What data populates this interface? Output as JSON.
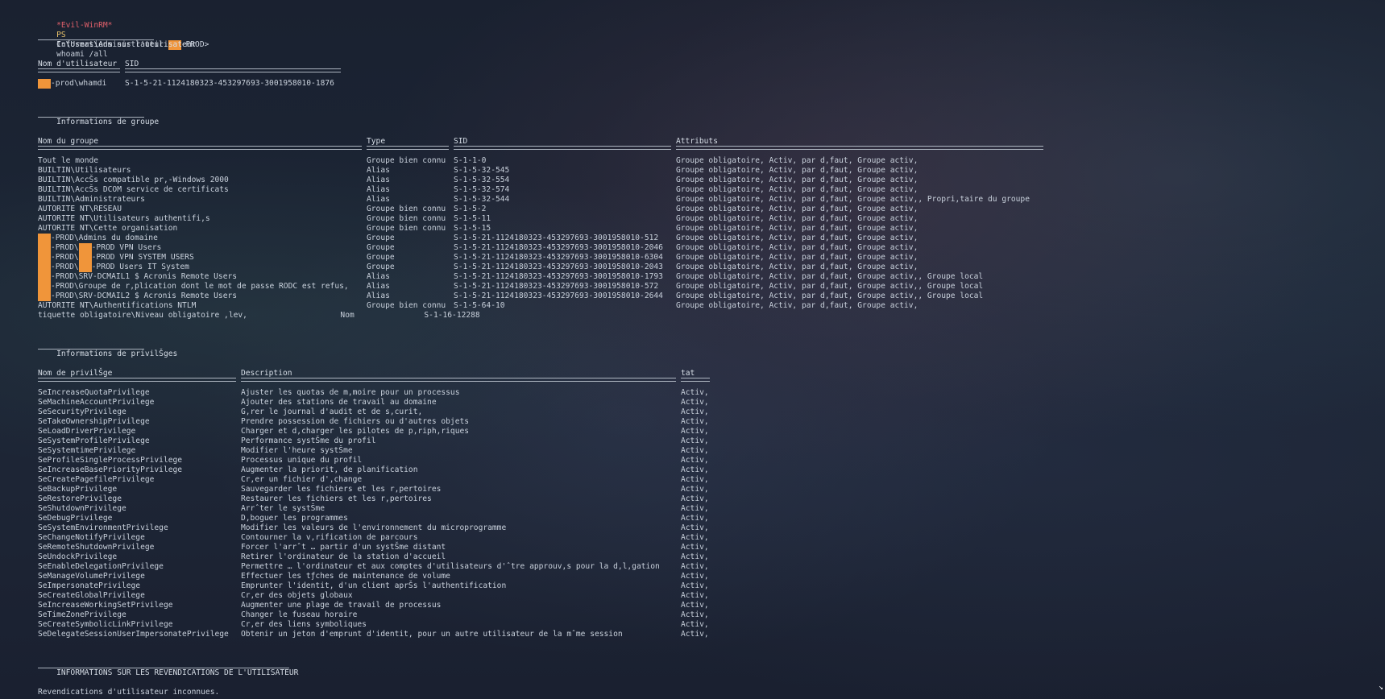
{
  "prompt": {
    "evil": "*Evil-WinRM*",
    "ps": "PS",
    "path_prefix": "C:\\Users\\Administrateur.",
    "path_suffix": "-PROD>",
    "command": "whoami /all"
  },
  "user_section": {
    "title": "Informations sur l'utilisateur",
    "col_user": "Nom d'utilisateur",
    "col_sid": "SID",
    "user_suffix": "-prod\\whamdi",
    "user_sid": "S-1-5-21-1124180323-453297693-3001958010-1876"
  },
  "group_section": {
    "title": "Informations de groupe",
    "headers": [
      "Nom du groupe",
      "Type",
      "SID",
      "Attributs"
    ],
    "rows": [
      {
        "name": "Tout le monde",
        "type": "Groupe bien connu",
        "sid": "S-1-1-0",
        "attr": "Groupe obligatoire, Activ, par d,faut, Groupe activ,"
      },
      {
        "name": "BUILTIN\\Utilisateurs",
        "type": "Alias",
        "sid": "S-1-5-32-545",
        "attr": "Groupe obligatoire, Activ, par d,faut, Groupe activ,"
      },
      {
        "name": "BUILTIN\\AccŠs compatible pr,-Windows 2000",
        "type": "Alias",
        "sid": "S-1-5-32-554",
        "attr": "Groupe obligatoire, Activ, par d,faut, Groupe activ,"
      },
      {
        "name": "BUILTIN\\AccŠs DCOM service de certificats",
        "type": "Alias",
        "sid": "S-1-5-32-574",
        "attr": "Groupe obligatoire, Activ, par d,faut, Groupe activ,"
      },
      {
        "name": "BUILTIN\\Administrateurs",
        "type": "Alias",
        "sid": "S-1-5-32-544",
        "attr": "Groupe obligatoire, Activ, par d,faut, Groupe activ,, Propri,taire du groupe"
      },
      {
        "name": "AUTORITE NT\\RESEAU",
        "type": "Groupe bien connu",
        "sid": "S-1-5-2",
        "attr": "Groupe obligatoire, Activ, par d,faut, Groupe activ,"
      },
      {
        "name": "AUTORITE NT\\Utilisateurs authentifi,s",
        "type": "Groupe bien connu",
        "sid": "S-1-5-11",
        "attr": "Groupe obligatoire, Activ, par d,faut, Groupe activ,"
      },
      {
        "name": "AUTORITE NT\\Cette organisation",
        "type": "Groupe bien connu",
        "sid": "S-1-5-15",
        "attr": "Groupe obligatoire, Activ, par d,faut, Groupe activ,"
      },
      {
        "name": "-PROD\\Admins du domaine",
        "type": "Groupe",
        "sid": "S-1-5-21-1124180323-453297693-3001958010-512",
        "attr": "Groupe obligatoire, Activ, par d,faut, Groupe activ,",
        "redacted": 1
      },
      {
        "name": "-PROD\\   -PROD VPN Users",
        "type": "Groupe",
        "sid": "S-1-5-21-1124180323-453297693-3001958010-2046",
        "attr": "Groupe obligatoire, Activ, par d,faut, Groupe activ,",
        "redacted": 2
      },
      {
        "name": "-PROD\\   -PROD VPN SYSTEM USERS",
        "type": "Groupe",
        "sid": "S-1-5-21-1124180323-453297693-3001958010-6304",
        "attr": "Groupe obligatoire, Activ, par d,faut, Groupe activ,",
        "redacted": 2
      },
      {
        "name": "-PROD\\   -PROD Users IT System",
        "type": "Groupe",
        "sid": "S-1-5-21-1124180323-453297693-3001958010-2043",
        "attr": "Groupe obligatoire, Activ, par d,faut, Groupe activ,",
        "redacted": 2
      },
      {
        "name": "-PROD\\SRV-DCMAIL1 $ Acronis Remote Users",
        "type": "Alias",
        "sid": "S-1-5-21-1124180323-453297693-3001958010-1793",
        "attr": "Groupe obligatoire, Activ, par d,faut, Groupe activ,, Groupe local",
        "redacted": 1
      },
      {
        "name": "-PROD\\Groupe de r,plication dont le mot de passe RODC est refus,",
        "type": "Alias",
        "sid": "S-1-5-21-1124180323-453297693-3001958010-572",
        "attr": "Groupe obligatoire, Activ, par d,faut, Groupe activ,, Groupe local",
        "redacted": 1
      },
      {
        "name": "-PROD\\SRV-DCMAIL2 $ Acronis Remote Users",
        "type": "Alias",
        "sid": "S-1-5-21-1124180323-453297693-3001958010-2644",
        "attr": "Groupe obligatoire, Activ, par d,faut, Groupe activ,, Groupe local",
        "redacted": 1
      },
      {
        "name": "AUTORITE NT\\Authentifications NTLM",
        "type": "Groupe bien connu",
        "sid": "S-1-5-64-10",
        "attr": "Groupe obligatoire, Activ, par d,faut, Groupe activ,"
      }
    ],
    "last_line": "tiquette obligatoire\\Niveau obligatoire ,lev,                    Nom               S-1-16-12288"
  },
  "priv_section": {
    "title": "Informations de privilŠges",
    "headers": [
      "Nom de privilŠge",
      "Description",
      "tat"
    ],
    "rows": [
      {
        "name": "SeIncreaseQuotaPrivilege",
        "desc": "Ajuster les quotas de m,moire pour un processus",
        "state": "Activ,"
      },
      {
        "name": "SeMachineAccountPrivilege",
        "desc": "Ajouter des stations de travail au domaine",
        "state": "Activ,"
      },
      {
        "name": "SeSecurityPrivilege",
        "desc": "G,rer le journal d'audit et de s,curit,",
        "state": "Activ,"
      },
      {
        "name": "SeTakeOwnershipPrivilege",
        "desc": "Prendre possession de fichiers ou d'autres objets",
        "state": "Activ,"
      },
      {
        "name": "SeLoadDriverPrivilege",
        "desc": "Charger et d,charger les pilotes de p,riph,riques",
        "state": "Activ,"
      },
      {
        "name": "SeSystemProfilePrivilege",
        "desc": "Performance systŠme du profil",
        "state": "Activ,"
      },
      {
        "name": "SeSystemtimePrivilege",
        "desc": "Modifier l'heure systŠme",
        "state": "Activ,"
      },
      {
        "name": "SeProfileSingleProcessPrivilege",
        "desc": "Processus unique du profil",
        "state": "Activ,"
      },
      {
        "name": "SeIncreaseBasePriorityPrivilege",
        "desc": "Augmenter la priorit, de planification",
        "state": "Activ,"
      },
      {
        "name": "SeCreatePagefilePrivilege",
        "desc": "Cr,er un fichier d',change",
        "state": "Activ,"
      },
      {
        "name": "SeBackupPrivilege",
        "desc": "Sauvegarder les fichiers et les r,pertoires",
        "state": "Activ,"
      },
      {
        "name": "SeRestorePrivilege",
        "desc": "Restaurer les fichiers et les r,pertoires",
        "state": "Activ,"
      },
      {
        "name": "SeShutdownPrivilege",
        "desc": "Arrˆter le systŠme",
        "state": "Activ,"
      },
      {
        "name": "SeDebugPrivilege",
        "desc": "D,boguer les programmes",
        "state": "Activ,"
      },
      {
        "name": "SeSystemEnvironmentPrivilege",
        "desc": "Modifier les valeurs de l'environnement du microprogramme",
        "state": "Activ,"
      },
      {
        "name": "SeChangeNotifyPrivilege",
        "desc": "Contourner la v,rification de parcours",
        "state": "Activ,"
      },
      {
        "name": "SeRemoteShutdownPrivilege",
        "desc": "Forcer l'arrˆt … partir d'un systŠme distant",
        "state": "Activ,"
      },
      {
        "name": "SeUndockPrivilege",
        "desc": "Retirer l'ordinateur de la station d'accueil",
        "state": "Activ,"
      },
      {
        "name": "SeEnableDelegationPrivilege",
        "desc": "Permettre … l'ordinateur et aux comptes d'utilisateurs d'ˆtre approuv,s pour la d,l,gation",
        "state": "Activ,"
      },
      {
        "name": "SeManageVolumePrivilege",
        "desc": "Effectuer les tƒches de maintenance de volume",
        "state": "Activ,"
      },
      {
        "name": "SeImpersonatePrivilege",
        "desc": "Emprunter l'identit, d'un client aprŠs l'authentification",
        "state": "Activ,"
      },
      {
        "name": "SeCreateGlobalPrivilege",
        "desc": "Cr,er des objets globaux",
        "state": "Activ,"
      },
      {
        "name": "SeIncreaseWorkingSetPrivilege",
        "desc": "Augmenter une plage de travail de processus",
        "state": "Activ,"
      },
      {
        "name": "SeTimeZonePrivilege",
        "desc": "Changer le fuseau horaire",
        "state": "Activ,"
      },
      {
        "name": "SeCreateSymbolicLinkPrivilege",
        "desc": "Cr,er des liens symboliques",
        "state": "Activ,"
      },
      {
        "name": "SeDelegateSessionUserImpersonatePrivilege",
        "desc": "Obtenir un jeton d'emprunt d'identit, pour un autre utilisateur de la mˆme session",
        "state": "Activ,"
      }
    ]
  },
  "claims_section": {
    "title": "INFORMATIONS SUR LES REVENDICATIONS DE L'UTILISATEUR",
    "message": "Revendications d'utilisateur inconnues."
  },
  "colors": {
    "background": "#1c2636",
    "text": "#c9d1dc",
    "prompt_evil": "#e0606a",
    "prompt_ps": "#e5c06a",
    "redaction": "#f0953a"
  }
}
